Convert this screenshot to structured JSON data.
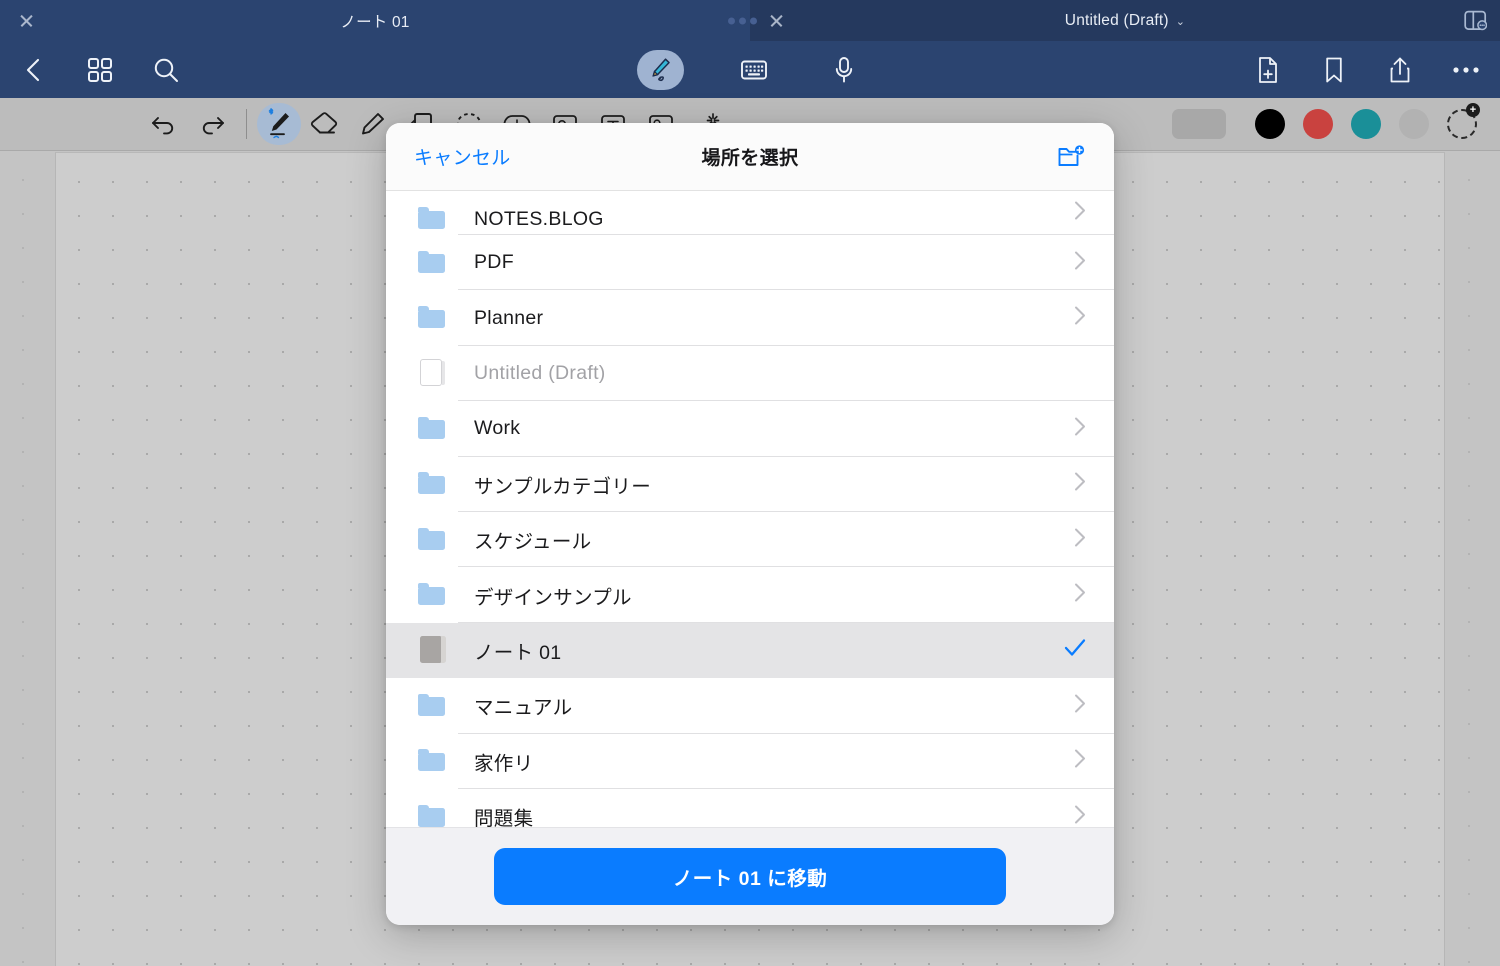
{
  "window": {
    "tabs": [
      {
        "title": "ノート 01",
        "active": true,
        "close_icon": "close-icon"
      },
      {
        "title": "Untitled (Draft)",
        "active": false,
        "chevron": "⌄",
        "close_icon": "close-icon"
      }
    ],
    "splitview_icon": "split-view-icon"
  },
  "navbar": {
    "left": [
      {
        "name": "back-icon",
        "label": "戻る"
      },
      {
        "name": "grid-icon",
        "label": "サムネール"
      },
      {
        "name": "search-icon",
        "label": "検索"
      }
    ],
    "center": [
      {
        "name": "pen-icon",
        "label": "手書き",
        "selected": true
      },
      {
        "name": "keyboard-icon",
        "label": "キーボード",
        "selected": false
      },
      {
        "name": "microphone-icon",
        "label": "録音",
        "selected": false
      }
    ],
    "right": [
      {
        "name": "new-page-icon",
        "label": "ページを追加"
      },
      {
        "name": "bookmark-icon",
        "label": "ブックマーク"
      },
      {
        "name": "share-icon",
        "label": "共有"
      },
      {
        "name": "more-icon",
        "label": "その他"
      }
    ]
  },
  "toolbar": {
    "history": [
      {
        "name": "undo-icon",
        "label": "元に戻す"
      },
      {
        "name": "redo-icon",
        "label": "やり直す"
      }
    ],
    "tools": [
      {
        "name": "pen-tool-icon",
        "label": "ペン",
        "selected": true
      },
      {
        "name": "eraser-tool-icon",
        "label": "消しゴム",
        "selected": false
      },
      {
        "name": "highlighter-tool-icon",
        "label": "蛍光ペン",
        "selected": false
      },
      {
        "name": "shape-tool-icon",
        "label": "図形",
        "selected": false
      },
      {
        "name": "lasso-tool-icon",
        "label": "なげなわ",
        "selected": false
      },
      {
        "name": "zoom-tool-icon",
        "label": "ズーム",
        "selected": false
      },
      {
        "name": "image-tool-icon",
        "label": "画像",
        "selected": false
      },
      {
        "name": "text-tool-icon",
        "label": "テキスト",
        "selected": false
      },
      {
        "name": "sticker-tool-icon",
        "label": "ステッカー",
        "selected": false
      },
      {
        "name": "effect-tool-icon",
        "label": "エフェクト",
        "selected": false
      }
    ],
    "colors": [
      {
        "name": "color-swatch-black",
        "hex": "#000000"
      },
      {
        "name": "color-swatch-red",
        "hex": "#c9423f"
      },
      {
        "name": "color-swatch-teal",
        "hex": "#1a8f98"
      },
      {
        "name": "color-swatch-gray",
        "hex": "#b2b2b2"
      }
    ],
    "add_color": {
      "name": "add-color-icon",
      "label": "色を追加"
    }
  },
  "modal": {
    "cancel_label": "キャンセル",
    "title": "場所を選択",
    "new_folder_icon": "new-folder-icon",
    "items": [
      {
        "label": "NOTES.BLOG",
        "icon": "folder-icon",
        "state": "normal",
        "accessory": "chevron"
      },
      {
        "label": "PDF",
        "icon": "folder-icon",
        "state": "normal",
        "accessory": "chevron"
      },
      {
        "label": "Planner",
        "icon": "folder-icon",
        "state": "normal",
        "accessory": "chevron"
      },
      {
        "label": "Untitled (Draft)",
        "icon": "document-icon",
        "state": "disabled",
        "accessory": "none"
      },
      {
        "label": "Work",
        "icon": "folder-icon",
        "state": "normal",
        "accessory": "chevron"
      },
      {
        "label": "サンプルカテゴリー",
        "icon": "folder-icon",
        "state": "normal",
        "accessory": "chevron"
      },
      {
        "label": "スケジュール",
        "icon": "folder-icon",
        "state": "normal",
        "accessory": "chevron"
      },
      {
        "label": "デザインサンプル",
        "icon": "folder-icon",
        "state": "normal",
        "accessory": "chevron"
      },
      {
        "label": "ノート 01",
        "icon": "notebook-icon",
        "state": "selected",
        "accessory": "checkmark"
      },
      {
        "label": "マニュアル",
        "icon": "folder-icon",
        "state": "normal",
        "accessory": "chevron"
      },
      {
        "label": "家作リ",
        "icon": "folder-icon",
        "state": "normal",
        "accessory": "chevron"
      },
      {
        "label": "問題集",
        "icon": "folder-icon",
        "state": "normal",
        "accessory": "chevron"
      }
    ],
    "primary_button_label": "ノート 01 に移動"
  },
  "colors": {
    "accent_blue": "#0a7cff",
    "navbar_blue": "#2b4470",
    "toolbar_gray": "#bcbcbc",
    "selected_row": "#e4e4e6"
  }
}
